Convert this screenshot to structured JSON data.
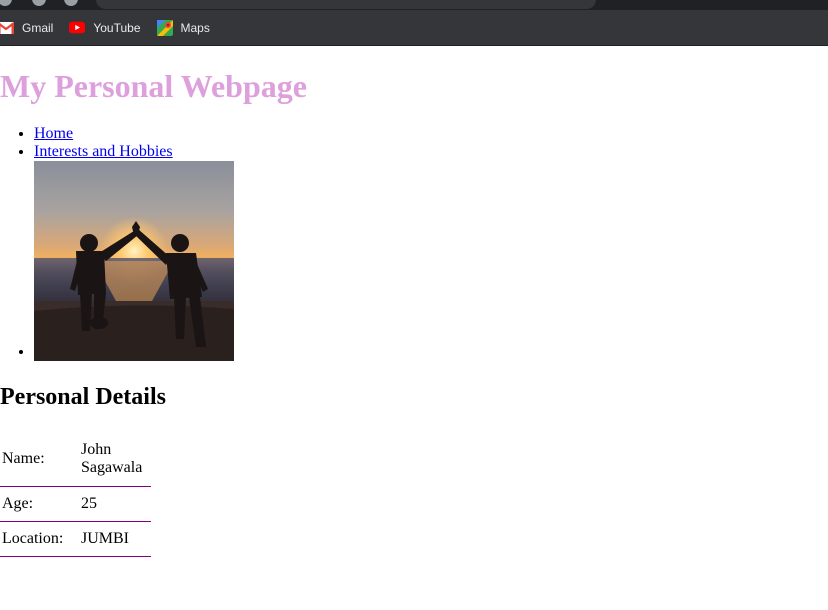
{
  "browser": {
    "bookmarks": [
      {
        "label": "Gmail",
        "icon": "gmail-icon"
      },
      {
        "label": "YouTube",
        "icon": "youtube-icon"
      },
      {
        "label": "Maps",
        "icon": "maps-icon"
      }
    ]
  },
  "page": {
    "title": "My Personal Webpage",
    "title_color": "#dda0dd",
    "nav": [
      {
        "label": "Home"
      },
      {
        "label": "Interests and Hobbies"
      }
    ],
    "photo_icon": "sunset-beach-high-five-photo",
    "details_heading": "Personal Details",
    "details": [
      {
        "label": "Name:",
        "value": "John Sagawala"
      },
      {
        "label": "Age:",
        "value": "25"
      },
      {
        "label": "Location:",
        "value": "JUMBI"
      }
    ],
    "row_border_color": "#800080"
  }
}
